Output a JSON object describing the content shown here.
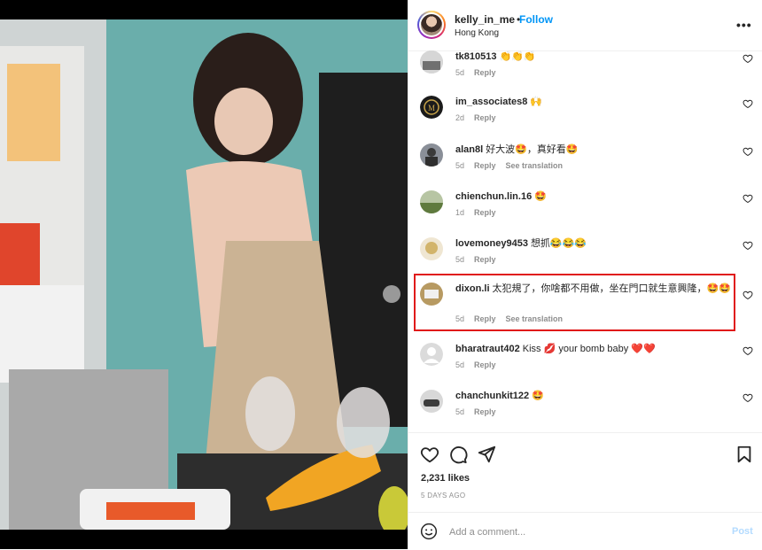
{
  "header": {
    "username": "kelly_in_me",
    "separator": "•",
    "follow_label": "Follow",
    "location": "Hong Kong",
    "more_icon": "more-horizontal-icon"
  },
  "comments": [
    {
      "user": "tk810513",
      "text": "👏👏👏",
      "age": "5d",
      "reply": "Reply",
      "translation": ""
    },
    {
      "user": "im_associates8",
      "text": "🙌",
      "age": "2d",
      "reply": "Reply",
      "translation": ""
    },
    {
      "user": "alan8l",
      "text": "好大波🤩，真好看🤩",
      "age": "5d",
      "reply": "Reply",
      "translation": "See translation"
    },
    {
      "user": "chienchun.lin.16",
      "text": "🤩",
      "age": "1d",
      "reply": "Reply",
      "translation": ""
    },
    {
      "user": "lovemoney9453",
      "text": "想抓😂😂😂",
      "age": "5d",
      "reply": "Reply",
      "translation": ""
    },
    {
      "user": "dixon.li",
      "text": "太犯規了，你啥都不用做，坐在門口就生意興隆，🤩🤩",
      "age": "5d",
      "reply": "Reply",
      "translation": "See translation"
    },
    {
      "user": "bharatraut402",
      "text": "Kiss 💋 your bomb baby ❤️❤️",
      "age": "5d",
      "reply": "Reply",
      "translation": ""
    },
    {
      "user": "chanchunkit122",
      "text": "🤩",
      "age": "5d",
      "reply": "Reply",
      "translation": ""
    }
  ],
  "actions": {
    "likes": "2,231 likes",
    "date": "5 DAYS AGO"
  },
  "add_comment": {
    "placeholder": "Add a comment...",
    "post_label": "Post"
  },
  "colors": {
    "accent": "#0095f6",
    "highlight": "#e01a1a",
    "muted": "#8e8e8e"
  }
}
